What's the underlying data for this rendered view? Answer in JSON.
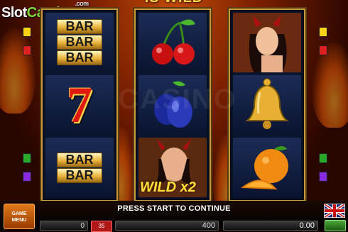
{
  "logo": {
    "part1": "Slot",
    "part2": "Catalog",
    "suffix": ".com"
  },
  "banner": {
    "text": "IS WILD"
  },
  "reels": [
    {
      "symbols": [
        {
          "name": "triple-bar",
          "lines": [
            "BAR",
            "BAR",
            "BAR"
          ]
        },
        {
          "name": "seven",
          "label": "7"
        },
        {
          "name": "double-bar",
          "lines": [
            "BAR",
            "BAR"
          ]
        }
      ]
    },
    {
      "symbols": [
        {
          "name": "cherries"
        },
        {
          "name": "plum"
        },
        {
          "name": "wild-devil",
          "wild_text": "WILD x2"
        }
      ]
    },
    {
      "symbols": [
        {
          "name": "devil-woman"
        },
        {
          "name": "bell"
        },
        {
          "name": "orange"
        }
      ]
    }
  ],
  "status": {
    "message": "PRESS START TO CONTINUE"
  },
  "controls": {
    "game_menu": "GAME MENU",
    "credit_value": "0",
    "bet_chip": "35",
    "bet_value": "400",
    "win_value": "0.00"
  },
  "colors": {
    "accent": "#ffd24a",
    "reel_border": "#c89a3a",
    "menu": "#e07a1a"
  }
}
